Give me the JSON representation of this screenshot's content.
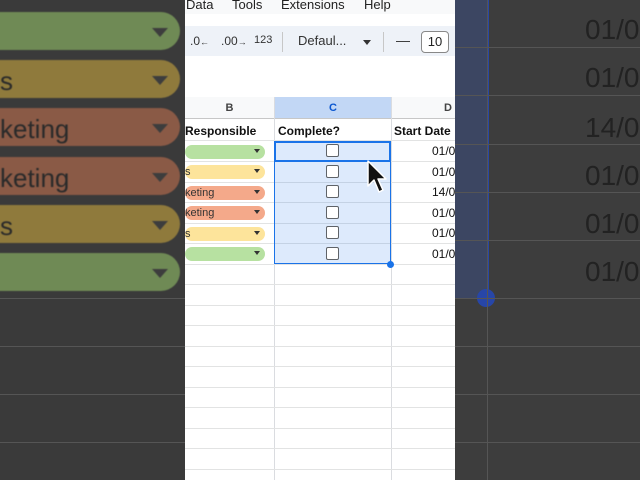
{
  "menu": [
    "Data",
    "Tools",
    "Extensions",
    "Help"
  ],
  "toolbar": {
    "decrease_decimal": ".0",
    "increase_decimal": ".00",
    "number_format": "123",
    "font_name": "Defaul...",
    "minus": "—",
    "font_size": "10"
  },
  "columns": {
    "b": "B",
    "c": "C",
    "d": "D"
  },
  "headers": {
    "responsible": "Responsible",
    "complete": "Complete?",
    "start_date": "Start Date"
  },
  "rows": [
    {
      "responsible": "",
      "color": "#b7e1a1",
      "date": "01/0"
    },
    {
      "responsible": "s",
      "color": "#fde49b",
      "date": "01/0"
    },
    {
      "responsible": "keting",
      "color": "#f4a98a",
      "date": "14/0"
    },
    {
      "responsible": "keting",
      "color": "#f4a98a",
      "date": "01/0"
    },
    {
      "responsible": "s",
      "color": "#fde49b",
      "date": "01/0"
    },
    {
      "responsible": "",
      "color": "#b7e1a1",
      "date": "01/0"
    }
  ],
  "bg_left": {
    "pills": [
      {
        "text": "",
        "color": "#6f8a55"
      },
      {
        "text": "s",
        "color": "#8f7a3c"
      },
      {
        "text": "keting",
        "color": "#8a5a46"
      },
      {
        "text": "keting",
        "color": "#8a5a46"
      },
      {
        "text": "s",
        "color": "#8f7a3c"
      },
      {
        "text": "",
        "color": "#6f8a55"
      }
    ]
  },
  "bg_right": {
    "dates": [
      "01/0",
      "01/0",
      "14/0",
      "01/0",
      "01/0",
      "01/0"
    ]
  },
  "colors": {
    "accent": "#1a73e8",
    "selected_header": "#c2d7f5"
  }
}
